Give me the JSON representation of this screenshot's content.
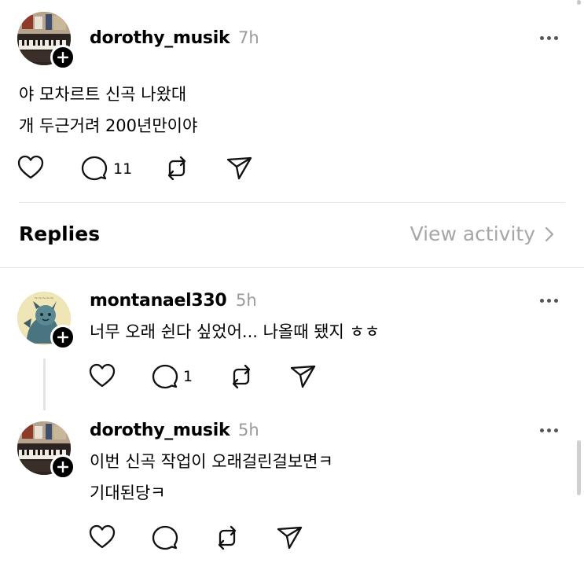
{
  "post": {
    "username": "dorothy_musik",
    "time": "7h",
    "lines": [
      "야 모차르트 신곡 나왔대",
      "개 두근거려 200년만이야"
    ],
    "reply_count": "11"
  },
  "replies_header": {
    "title": "Replies",
    "view_activity": "View activity"
  },
  "replies": [
    {
      "username": "montanael330",
      "time": "5h",
      "lines": [
        "너무 오래 쉰다 싶었어... 나올때 됐지 ㅎㅎ"
      ],
      "reply_count": "1"
    },
    {
      "username": "dorothy_musik",
      "time": "5h",
      "lines": [
        "이번 신곡 작업이 오래걸린걸보면ㅋ",
        "기대된당ㅋ"
      ],
      "reply_count": ""
    }
  ],
  "icons": {
    "like": "heart-icon",
    "comment": "comment-icon",
    "repost": "repost-icon",
    "share": "send-icon",
    "more": "more-icon",
    "follow": "plus-icon",
    "chevron": "chevron-right-icon"
  }
}
